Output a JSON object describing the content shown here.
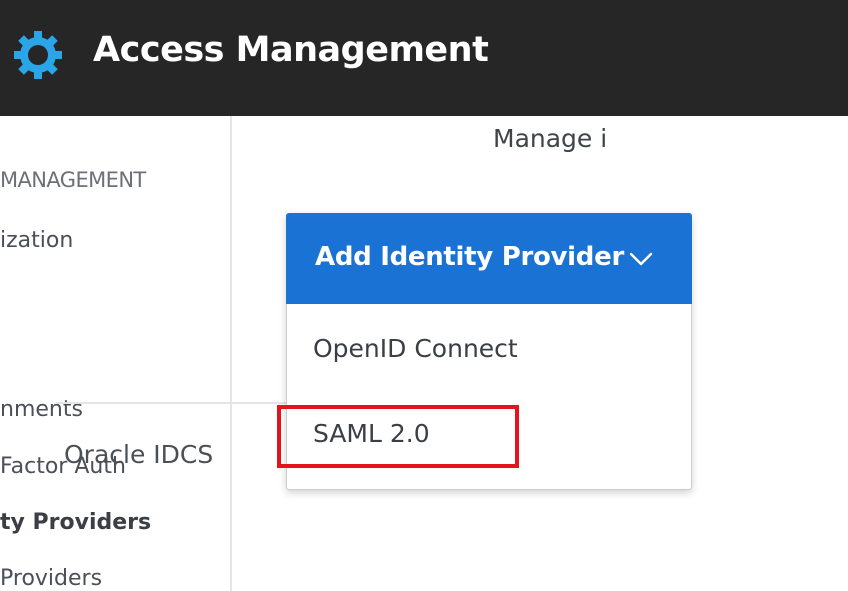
{
  "header": {
    "title": "Access Management",
    "logo_icon": "gear-icon",
    "logo_color": "#2aa6e8"
  },
  "sidebar": {
    "section_label": "MANAGEMENT",
    "items": [
      {
        "label": "ization"
      },
      {
        "label": "nments"
      },
      {
        "label": "Factor Auth"
      },
      {
        "label": "ty Providers",
        "active": true
      },
      {
        "label": "Providers"
      }
    ]
  },
  "main": {
    "tab_manage": "Manage i",
    "list_row": "Oracle IDCS"
  },
  "dropdown": {
    "button_label": "Add Identity Provider",
    "button_color": "#1a73d4",
    "chevron_icon": "chevron-down-icon",
    "options": [
      {
        "label": "OpenID Connect"
      },
      {
        "label": "SAML 2.0",
        "highlighted": true
      }
    ]
  },
  "annotation": {
    "highlight_color": "#e3141b"
  }
}
